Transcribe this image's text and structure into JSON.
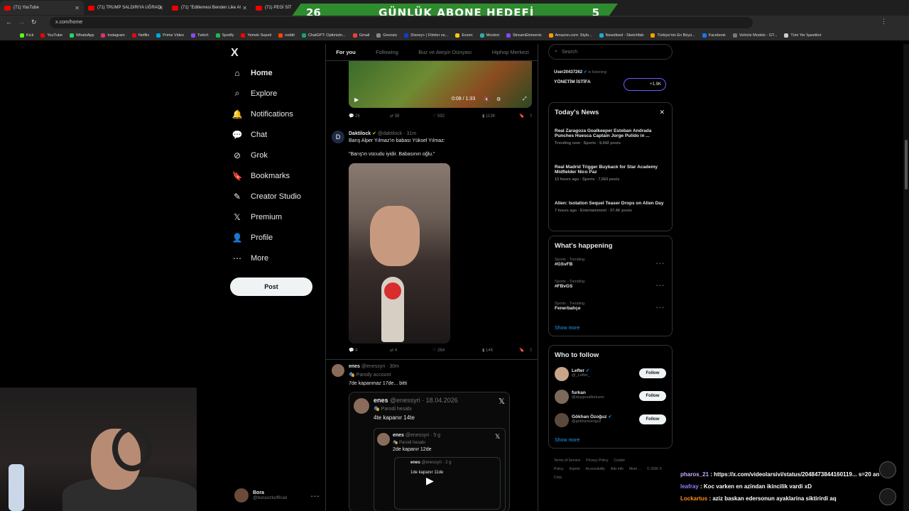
{
  "browser": {
    "tabs": [
      {
        "label": "(71) YouTube"
      },
      {
        "label": "(71) TRUMP SALDIRIYA UĞRADI"
      },
      {
        "label": "(71) \"Editlemesi Benden Like Al"
      },
      {
        "label": "(71) PEGİ SİT"
      }
    ],
    "url": "x.com/home",
    "bookmarks": [
      "Kick",
      "YouTube",
      "WhatsApp",
      "Instagram",
      "Netflix",
      "Prime Video",
      "Twitch",
      "Spotify",
      "Yemek Sepeti",
      "reddit",
      "ChatGPT: Optimizin...",
      "Gmail",
      "Gnoosic",
      "Disney+ | Filmler ve...",
      "Exxen",
      "Moobot",
      "StreamElements",
      "Amazon.com: Stylo...",
      "Newsfeed - Sketchfab",
      "Türkiye'nin En Büyü...",
      "Facebook",
      "Vehicle Models - GT...",
      "Tüm Yer İşaretleri"
    ]
  },
  "banner": {
    "left_number": "26",
    "text": "GÜNLÜK ABONE HEDEFİ",
    "right_number": "5"
  },
  "nav": {
    "logo": "X",
    "items": [
      {
        "label": "Home",
        "icon": "home-icon"
      },
      {
        "label": "Explore",
        "icon": "search-icon"
      },
      {
        "label": "Notifications",
        "icon": "bell-icon"
      },
      {
        "label": "Chat",
        "icon": "chat-icon"
      },
      {
        "label": "Grok",
        "icon": "grok-icon"
      },
      {
        "label": "Bookmarks",
        "icon": "bookmark-icon"
      },
      {
        "label": "Creator Studio",
        "icon": "creator-icon"
      },
      {
        "label": "Premium",
        "icon": "x-icon"
      },
      {
        "label": "Profile",
        "icon": "person-icon"
      },
      {
        "label": "More",
        "icon": "more-icon"
      }
    ],
    "post_label": "Post",
    "user_name": "Bora",
    "user_handle": "@boraozkofficial"
  },
  "feed": {
    "tabs": [
      "For you",
      "Following",
      "Buz ve Ateşin Dünyası",
      "Hiphop Merkezi"
    ],
    "video1": {
      "time": "0:08 / 1:33",
      "replies": "26",
      "reposts": "58",
      "likes": "592",
      "views": "113K"
    },
    "tweet2": {
      "name": "Daktilock",
      "handle": "@daktilock · 31m",
      "line1": "Barış Alper Yılmaz'ın babası Yüksel Yılmaz:",
      "line2": "\"Barış'ın vücudu iyidir. Babasının oğlu.\"",
      "replies": "4",
      "reposts": "4",
      "likes": "264",
      "views": "14K"
    },
    "tweet3": {
      "name": "enes",
      "handle": "@enessyri · 30m",
      "badge": "Parody account",
      "text": "7de kapanmaz 17de... bitti",
      "quote1": {
        "name": "enes",
        "handle": "@enessyri · 18.04.2026",
        "badge": "Parodi hesabı",
        "text": "4te kapanır 14te"
      },
      "quote2": {
        "name": "enes",
        "handle": "@enessyri · 5 g",
        "badge": "Parodi hesabı",
        "text": "2de kapanır 12de"
      },
      "quote3": {
        "name": "enes",
        "handle": "@enessyri · 2 g",
        "text": "1de kapanır 11de"
      }
    }
  },
  "sidebar": {
    "search_placeholder": "Search",
    "live": {
      "user": "User20437262",
      "status": "is listening",
      "title": "YÖNETİM İSTİFA",
      "count": "+1.9K"
    },
    "news_title": "Today's News",
    "news": [
      {
        "title": "Real Zaragoza Goalkeeper Esteban Andrada Punches Huesca Captain Jorge Pulido in ...",
        "meta": "Trending now · Sports · 9,442 posts"
      },
      {
        "title": "Real Madrid Trigger Buyback for Star Academy Midfielder Nico Paz",
        "meta": "13 hours ago · Sports · 7,563 posts"
      },
      {
        "title": "Alien: Isolation Sequel Teaser Drops on Alien Day",
        "meta": "7 hours ago · Entertainment · 37.4K posts"
      }
    ],
    "happening_title": "What's happening",
    "trends": [
      {
        "meta": "Sports · Trending",
        "tag": "#GSvFB"
      },
      {
        "meta": "Sports · Trending",
        "tag": "#FBvGS"
      },
      {
        "meta": "Sports · Trending",
        "tag": "Fenerbahçe"
      }
    ],
    "show_more": "Show more",
    "who_title": "Who to follow",
    "follow": [
      {
        "name": "Lefter",
        "handle": "@_Lefter_"
      },
      {
        "name": "furkan",
        "handle": "@duygusalfurkann"
      },
      {
        "name": "Gökhan Özoğuz",
        "handle": "@gokhanozoguz"
      }
    ],
    "follow_label": "Follow",
    "show_more2": "Show more",
    "footer": [
      "Terms of Service",
      "Privacy Policy",
      "Cookie Policy",
      "Imprint",
      "Accessibility",
      "Ads info",
      "More ...",
      "© 2026 X Corp."
    ]
  },
  "chat": [
    {
      "user": "pharos_21",
      "msg": "https://x.com/videolarsivi/status/2048473844160119... s=20 anlık boraozk",
      "color": "#c9a7ff"
    },
    {
      "user": "leafray",
      "msg": "Koc varken en azindan ikincilik vardi xD",
      "color": "#9a7bff"
    },
    {
      "user": "Lockartus",
      "msg": "aziz baskan edersonun ayaklarina siktirirdi aq",
      "color": "#ff8c1a"
    }
  ],
  "colors": {
    "accent": "#1d9bf0",
    "banner": "#2e8b2e"
  }
}
